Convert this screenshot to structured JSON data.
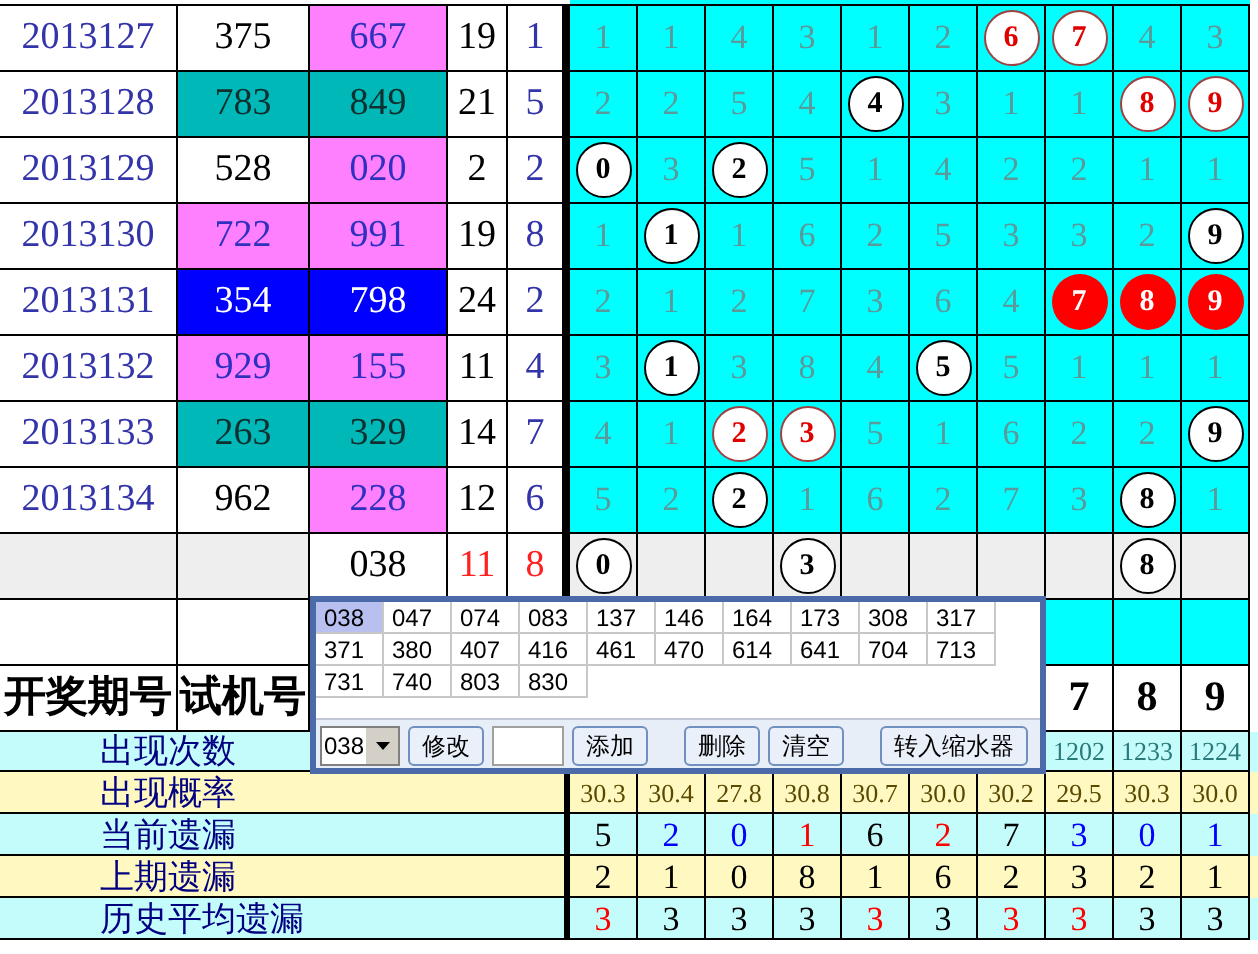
{
  "draws": [
    {
      "period": "2013127",
      "test": {
        "value": "375",
        "kind": "plain"
      },
      "draw": {
        "value": "667",
        "kind": "pink"
      },
      "cell_4": "19",
      "cell_5": "1",
      "grid": [
        {
          "value": "1",
          "kind": "miss"
        },
        {
          "value": "1",
          "kind": "miss"
        },
        {
          "value": "4",
          "kind": "miss"
        },
        {
          "value": "3",
          "kind": "miss"
        },
        {
          "value": "1",
          "kind": "miss"
        },
        {
          "value": "2",
          "kind": "miss"
        },
        {
          "value": "6",
          "kind": "hit_red"
        },
        {
          "value": "7",
          "kind": "hit_red"
        },
        {
          "value": "4",
          "kind": "miss"
        },
        {
          "value": "3",
          "kind": "miss"
        }
      ]
    },
    {
      "period": "2013128",
      "test": {
        "value": "783",
        "kind": "teal"
      },
      "draw": {
        "value": "849",
        "kind": "teal"
      },
      "cell_4": "21",
      "cell_5": "5",
      "grid": [
        {
          "value": "2",
          "kind": "miss"
        },
        {
          "value": "2",
          "kind": "miss"
        },
        {
          "value": "5",
          "kind": "miss"
        },
        {
          "value": "4",
          "kind": "miss"
        },
        {
          "value": "4",
          "kind": "hit"
        },
        {
          "value": "3",
          "kind": "miss"
        },
        {
          "value": "1",
          "kind": "miss"
        },
        {
          "value": "1",
          "kind": "miss"
        },
        {
          "value": "8",
          "kind": "hit_red"
        },
        {
          "value": "9",
          "kind": "hit_red"
        }
      ]
    },
    {
      "period": "2013129",
      "test": {
        "value": "528",
        "kind": "plain"
      },
      "draw": {
        "value": "020",
        "kind": "pink"
      },
      "cell_4": "2",
      "cell_5": "2",
      "grid": [
        {
          "value": "0",
          "kind": "hit"
        },
        {
          "value": "3",
          "kind": "miss"
        },
        {
          "value": "2",
          "kind": "hit"
        },
        {
          "value": "5",
          "kind": "miss"
        },
        {
          "value": "1",
          "kind": "miss"
        },
        {
          "value": "4",
          "kind": "miss"
        },
        {
          "value": "2",
          "kind": "miss"
        },
        {
          "value": "2",
          "kind": "miss"
        },
        {
          "value": "1",
          "kind": "miss"
        },
        {
          "value": "1",
          "kind": "miss"
        }
      ]
    },
    {
      "period": "2013130",
      "test": {
        "value": "722",
        "kind": "pink"
      },
      "draw": {
        "value": "991",
        "kind": "pink"
      },
      "cell_4": "19",
      "cell_5": "8",
      "grid": [
        {
          "value": "1",
          "kind": "miss"
        },
        {
          "value": "1",
          "kind": "hit"
        },
        {
          "value": "1",
          "kind": "miss"
        },
        {
          "value": "6",
          "kind": "miss"
        },
        {
          "value": "2",
          "kind": "miss"
        },
        {
          "value": "5",
          "kind": "miss"
        },
        {
          "value": "3",
          "kind": "miss"
        },
        {
          "value": "3",
          "kind": "miss"
        },
        {
          "value": "2",
          "kind": "miss"
        },
        {
          "value": "9",
          "kind": "hit"
        }
      ]
    },
    {
      "period": "2013131",
      "test": {
        "value": "354",
        "kind": "blue"
      },
      "draw": {
        "value": "798",
        "kind": "blue"
      },
      "cell_4": "24",
      "cell_5": "2",
      "grid": [
        {
          "value": "2",
          "kind": "miss"
        },
        {
          "value": "1",
          "kind": "miss"
        },
        {
          "value": "2",
          "kind": "miss"
        },
        {
          "value": "7",
          "kind": "miss"
        },
        {
          "value": "3",
          "kind": "miss"
        },
        {
          "value": "6",
          "kind": "miss"
        },
        {
          "value": "4",
          "kind": "miss"
        },
        {
          "value": "7",
          "kind": "hit_fill"
        },
        {
          "value": "8",
          "kind": "hit_fill"
        },
        {
          "value": "9",
          "kind": "hit_fill"
        }
      ]
    },
    {
      "period": "2013132",
      "test": {
        "value": "929",
        "kind": "pink"
      },
      "draw": {
        "value": "155",
        "kind": "pink"
      },
      "cell_4": "11",
      "cell_5": "4",
      "grid": [
        {
          "value": "3",
          "kind": "miss"
        },
        {
          "value": "1",
          "kind": "hit"
        },
        {
          "value": "3",
          "kind": "miss"
        },
        {
          "value": "8",
          "kind": "miss"
        },
        {
          "value": "4",
          "kind": "miss"
        },
        {
          "value": "5",
          "kind": "hit"
        },
        {
          "value": "5",
          "kind": "miss"
        },
        {
          "value": "1",
          "kind": "miss"
        },
        {
          "value": "1",
          "kind": "miss"
        },
        {
          "value": "1",
          "kind": "miss"
        }
      ]
    },
    {
      "period": "2013133",
      "test": {
        "value": "263",
        "kind": "teal"
      },
      "draw": {
        "value": "329",
        "kind": "teal"
      },
      "cell_4": "14",
      "cell_5": "7",
      "grid": [
        {
          "value": "4",
          "kind": "miss"
        },
        {
          "value": "1",
          "kind": "miss"
        },
        {
          "value": "2",
          "kind": "hit_red"
        },
        {
          "value": "3",
          "kind": "hit_red"
        },
        {
          "value": "5",
          "kind": "miss"
        },
        {
          "value": "1",
          "kind": "miss"
        },
        {
          "value": "6",
          "kind": "miss"
        },
        {
          "value": "2",
          "kind": "miss"
        },
        {
          "value": "2",
          "kind": "miss"
        },
        {
          "value": "9",
          "kind": "hit"
        }
      ]
    },
    {
      "period": "2013134",
      "test": {
        "value": "962",
        "kind": "plain"
      },
      "draw": {
        "value": "228",
        "kind": "pink"
      },
      "cell_4": "12",
      "cell_5": "6",
      "grid": [
        {
          "value": "5",
          "kind": "miss"
        },
        {
          "value": "2",
          "kind": "miss"
        },
        {
          "value": "2",
          "kind": "hit"
        },
        {
          "value": "1",
          "kind": "miss"
        },
        {
          "value": "6",
          "kind": "miss"
        },
        {
          "value": "2",
          "kind": "miss"
        },
        {
          "value": "7",
          "kind": "miss"
        },
        {
          "value": "3",
          "kind": "miss"
        },
        {
          "value": "8",
          "kind": "hit"
        },
        {
          "value": "1",
          "kind": "miss"
        }
      ]
    }
  ],
  "trial_row": {
    "draw": "038",
    "cell_4": "11",
    "cell_5": "8",
    "grid": [
      {
        "value": "0",
        "kind": "hit"
      },
      {
        "kind": "empty"
      },
      {
        "kind": "empty"
      },
      {
        "value": "3",
        "kind": "hit"
      },
      {
        "kind": "empty"
      },
      {
        "kind": "empty"
      },
      {
        "kind": "empty"
      },
      {
        "kind": "empty"
      },
      {
        "value": "8",
        "kind": "hit"
      },
      {
        "kind": "empty"
      }
    ]
  },
  "header": {
    "column_1": "开奖期号",
    "column_2": "试机号",
    "digits": [
      "7",
      "8",
      "9"
    ]
  },
  "stats": [
    {
      "label": "出现次数",
      "kind": "cyan",
      "values": [
        {
          "text": "1202",
          "color": "#2a7a7a"
        },
        {
          "text": "1233",
          "color": "#2a7a7a"
        },
        {
          "text": "1224",
          "color": "#2a7a7a"
        }
      ]
    },
    {
      "label": "出现概率",
      "kind": "yellow",
      "values": [
        {
          "text": "30.3",
          "color": "#5a4a00"
        },
        {
          "text": "30.4",
          "color": "#5a4a00"
        },
        {
          "text": "27.8",
          "color": "#5a4a00"
        },
        {
          "text": "30.8",
          "color": "#5a4a00"
        },
        {
          "text": "30.7",
          "color": "#5a4a00"
        },
        {
          "text": "30.0",
          "color": "#5a4a00"
        },
        {
          "text": "30.2",
          "color": "#5a4a00"
        },
        {
          "text": "29.5",
          "color": "#5a4a00"
        },
        {
          "text": "30.3",
          "color": "#5a4a00"
        },
        {
          "text": "30.0",
          "color": "#5a4a00"
        }
      ]
    },
    {
      "label": "当前遗漏",
      "kind": "cyan",
      "values": [
        {
          "text": "5",
          "color": "#000000"
        },
        {
          "text": "2",
          "color": "#0000ff"
        },
        {
          "text": "0",
          "color": "#0000ff"
        },
        {
          "text": "1",
          "color": "#ff0000"
        },
        {
          "text": "6",
          "color": "#000000"
        },
        {
          "text": "2",
          "color": "#ff0000"
        },
        {
          "text": "7",
          "color": "#000000"
        },
        {
          "text": "3",
          "color": "#0000ff"
        },
        {
          "text": "0",
          "color": "#0000ff"
        },
        {
          "text": "1",
          "color": "#0000ff"
        }
      ]
    },
    {
      "label": "上期遗漏",
      "kind": "yellow",
      "values": [
        {
          "text": "2",
          "color": "#000000"
        },
        {
          "text": "1",
          "color": "#000000"
        },
        {
          "text": "0",
          "color": "#000000"
        },
        {
          "text": "8",
          "color": "#000000"
        },
        {
          "text": "1",
          "color": "#000000"
        },
        {
          "text": "6",
          "color": "#000000"
        },
        {
          "text": "2",
          "color": "#000000"
        },
        {
          "text": "3",
          "color": "#000000"
        },
        {
          "text": "2",
          "color": "#000000"
        },
        {
          "text": "1",
          "color": "#000000"
        }
      ]
    },
    {
      "label": "历史平均遗漏",
      "kind": "cyan",
      "values": [
        {
          "text": "3",
          "color": "#ff0000"
        },
        {
          "text": "3",
          "color": "#000000"
        },
        {
          "text": "3",
          "color": "#000000"
        },
        {
          "text": "3",
          "color": "#000000"
        },
        {
          "text": "3",
          "color": "#ff0000"
        },
        {
          "text": "3",
          "color": "#000000"
        },
        {
          "text": "3",
          "color": "#ff0000"
        },
        {
          "text": "3",
          "color": "#ff0000"
        },
        {
          "text": "3",
          "color": "#000000"
        },
        {
          "text": "3",
          "color": "#000000"
        }
      ]
    }
  ],
  "popup": {
    "numbers": [
      {
        "value": "038",
        "selected": true
      },
      {
        "value": "047",
        "selected": false
      },
      {
        "value": "074",
        "selected": false
      },
      {
        "value": "083",
        "selected": false
      },
      {
        "value": "137",
        "selected": false
      },
      {
        "value": "146",
        "selected": false
      },
      {
        "value": "164",
        "selected": false
      },
      {
        "value": "173",
        "selected": false
      },
      {
        "value": "308",
        "selected": false
      },
      {
        "value": "317",
        "selected": false
      },
      {
        "value": "371",
        "selected": false
      },
      {
        "value": "380",
        "selected": false
      },
      {
        "value": "407",
        "selected": false
      },
      {
        "value": "416",
        "selected": false
      },
      {
        "value": "461",
        "selected": false
      },
      {
        "value": "470",
        "selected": false
      },
      {
        "value": "614",
        "selected": false
      },
      {
        "value": "641",
        "selected": false
      },
      {
        "value": "704",
        "selected": false
      },
      {
        "value": "713",
        "selected": false
      },
      {
        "value": "731",
        "selected": false
      },
      {
        "value": "740",
        "selected": false
      },
      {
        "value": "803",
        "selected": false
      },
      {
        "value": "830",
        "selected": false
      }
    ],
    "select": "038",
    "controls": [
      {
        "kind": "button",
        "label": "修改"
      },
      {
        "kind": "input"
      },
      {
        "kind": "button",
        "label": "添加"
      },
      {
        "kind": "gap"
      },
      {
        "kind": "button",
        "label": "删除"
      },
      {
        "kind": "button",
        "label": "清空"
      },
      {
        "kind": "gap"
      },
      {
        "kind": "button",
        "label": "转入缩水器"
      }
    ]
  }
}
